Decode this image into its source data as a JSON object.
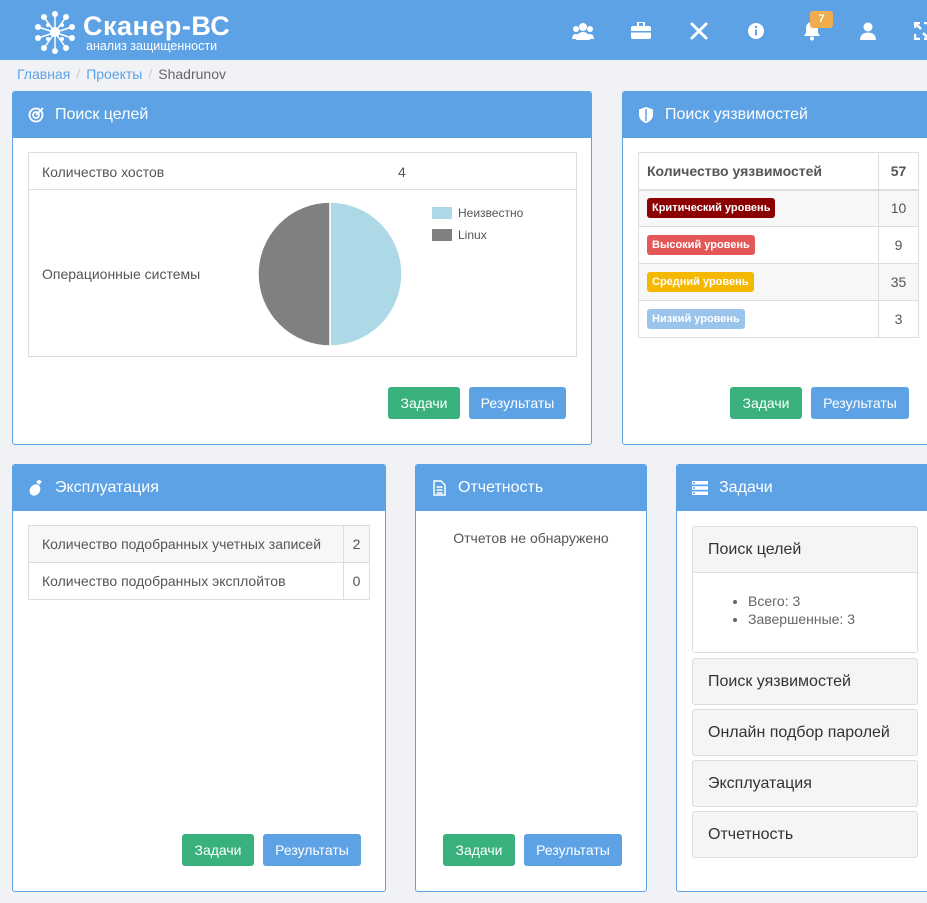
{
  "app": {
    "logo_title": "Сканер-ВС",
    "logo_subtitle": "анализ защищенности",
    "notification_count": "7"
  },
  "nav_icons": [
    "users-icon",
    "briefcase-icon",
    "tools-icon",
    "info-icon",
    "bell-icon",
    "user-icon",
    "fullscreen-icon"
  ],
  "breadcrumb": {
    "home": "Главная",
    "projects": "Проекты",
    "current": "Shadrunov"
  },
  "targets": {
    "title": "Поиск целей",
    "hosts_label": "Количество хостов",
    "hosts_value": "4",
    "os_label": "Операционные системы",
    "tasks_button": "Задачи",
    "results_button": "Результаты"
  },
  "chart_data": {
    "type": "pie",
    "series": [
      {
        "name": "Неизвестно",
        "value": 50,
        "color": "#add8e6"
      },
      {
        "name": "Linux",
        "value": 50,
        "color": "#808080"
      }
    ],
    "legend_position": "top-right"
  },
  "vulns": {
    "title": "Поиск уязвимостей",
    "header_label": "Количество уязвимостей",
    "header_value": "57",
    "rows": [
      {
        "label": "Критический уровень",
        "value": "10",
        "color": "#8b0000"
      },
      {
        "label": "Высокий уровень",
        "value": "9",
        "color": "#e45757"
      },
      {
        "label": "Средний уровень",
        "value": "35",
        "color": "#f5b800"
      },
      {
        "label": "Низкий уровень",
        "value": "3",
        "color": "#9bc4ec"
      }
    ],
    "tasks_button": "Задачи",
    "results_button": "Результаты"
  },
  "exploit": {
    "title": "Эксплуатация",
    "rows": [
      {
        "label": "Количество подобранных учетных записей",
        "value": "2"
      },
      {
        "label": "Количество подобранных эксплойтов",
        "value": "0"
      }
    ],
    "tasks_button": "Задачи",
    "results_button": "Результаты"
  },
  "reports": {
    "title": "Отчетность",
    "empty_text": "Отчетов не обнаружено",
    "tasks_button": "Задачи",
    "results_button": "Результаты"
  },
  "tasks": {
    "title": "Задачи",
    "sections": [
      {
        "title": "Поиск целей",
        "items": [
          "Всего: 3",
          "Завершенные: 3"
        ]
      },
      {
        "title": "Поиск уязвимостей"
      },
      {
        "title": "Онлайн подбор паролей"
      },
      {
        "title": "Эксплуатация"
      },
      {
        "title": "Отчетность"
      }
    ]
  }
}
